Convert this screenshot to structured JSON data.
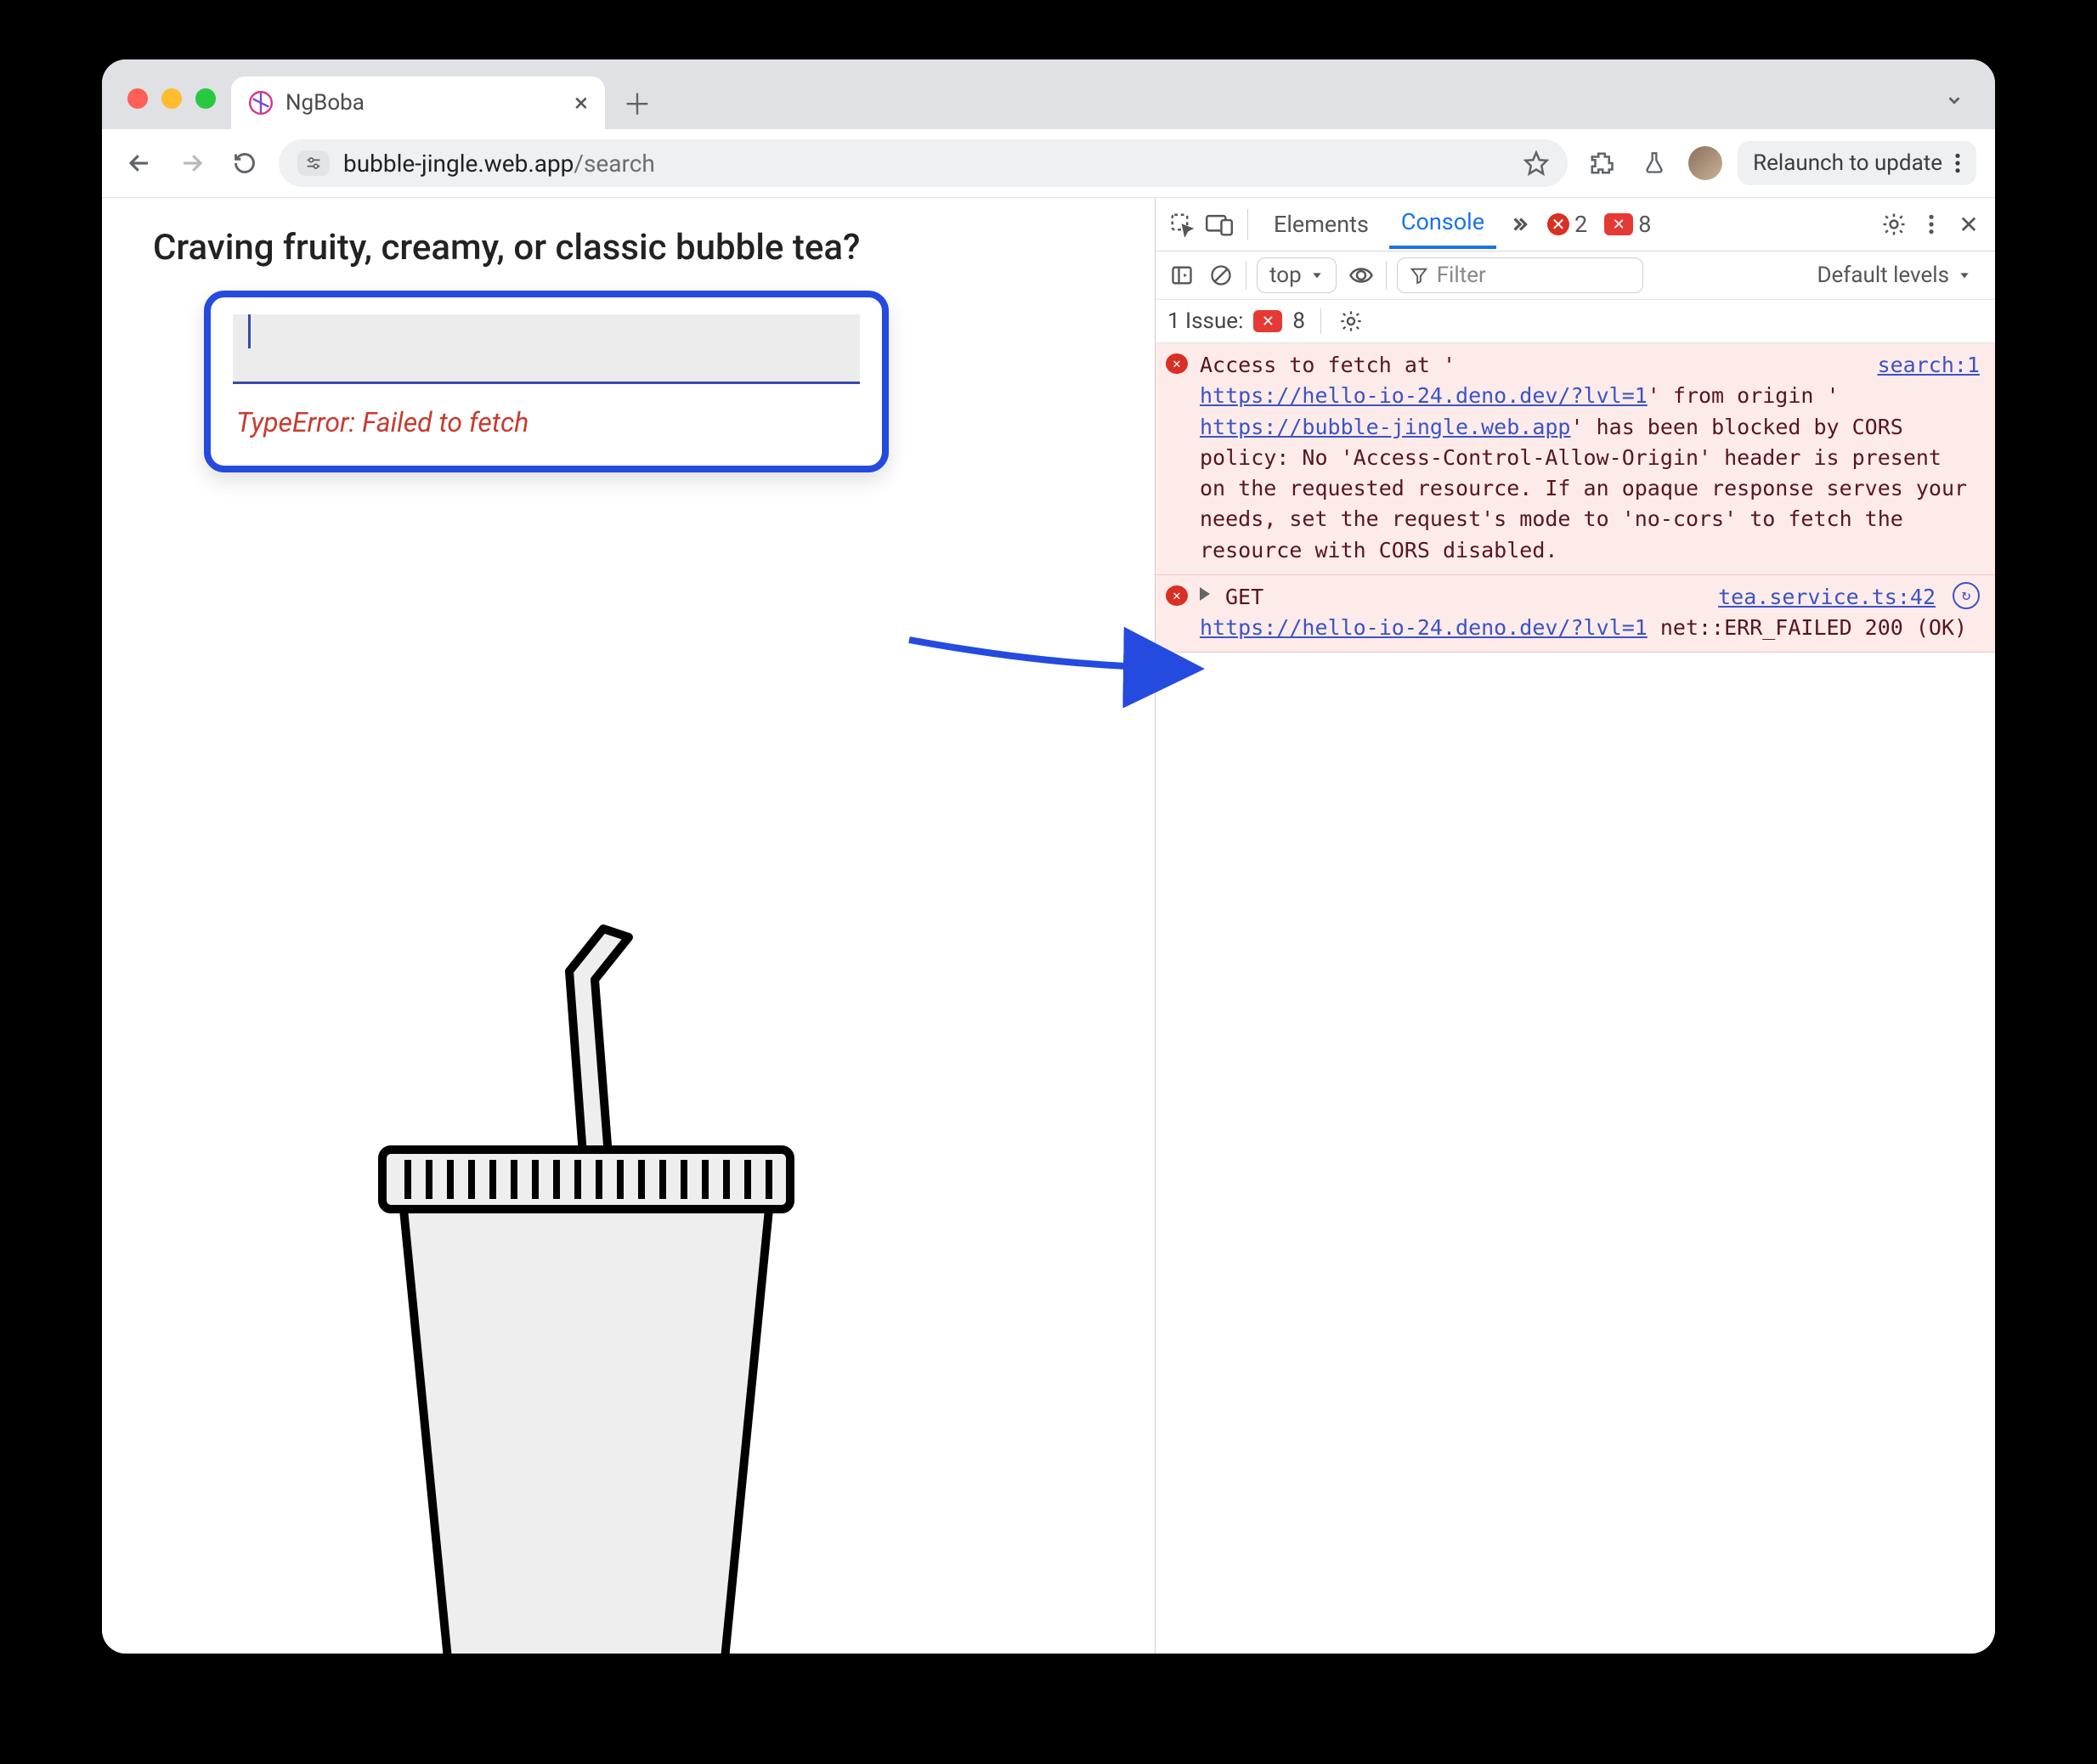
{
  "browser": {
    "tab_title": "NgBoba",
    "url_host": "bubble-jingle.web.app",
    "url_path": "/search",
    "update_label": "Relaunch to update"
  },
  "page": {
    "headline": "Craving fruity, creamy, or classic bubble tea?",
    "input_value": "",
    "error_text": "TypeError: Failed to fetch"
  },
  "devtools": {
    "tabs": {
      "elements": "Elements",
      "console": "Console"
    },
    "error_count": "2",
    "issue_count": "8",
    "toolbar": {
      "context": "top",
      "filter_placeholder": "Filter",
      "levels": "Default levels"
    },
    "issues_bar": {
      "label": "1 Issue:",
      "count": "8"
    },
    "logs": [
      {
        "pre": "Access to fetch at '",
        "url1": "https://hello-io-24.deno.dev/?lvl=1",
        "mid1": "' from origin '",
        "url2": "https://bubble-jingle.web.app",
        "rest": "' has been blocked by CORS policy: No 'Access-Control-Allow-Origin' header is present on the requested resource. If an opaque response serves your needs, set the request's mode to 'no-cors' to fetch the resource with CORS disabled.",
        "source": "search:1"
      },
      {
        "method": "GET",
        "url": "https://hello-io-24.deno.dev/?lvl=1",
        "tail": " net::ERR_FAILED 200 (OK)",
        "source": "tea.service.ts:42"
      }
    ]
  }
}
